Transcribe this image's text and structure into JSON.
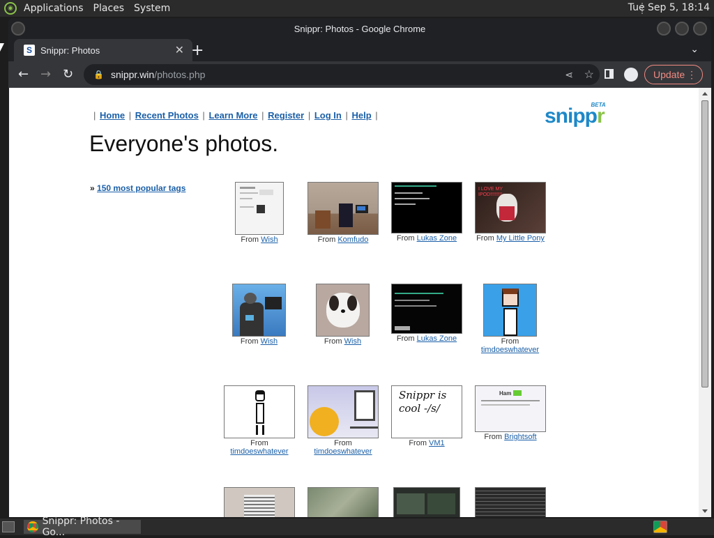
{
  "topbar": {
    "menu": [
      "Applications",
      "Places",
      "System"
    ],
    "clock": "Tue Sep  5, 18:14"
  },
  "window": {
    "title": "Snippr: Photos - Google Chrome",
    "tab_title": "Snippr: Photos",
    "tab_favicon": "S",
    "url_host": "snippr.win",
    "url_path": "/photos.php",
    "update_label": "Update"
  },
  "page": {
    "nav": [
      "Home",
      "Recent Photos",
      "Learn More",
      "Register",
      "Log In",
      "Help"
    ],
    "brand_main": "snipp",
    "brand_accent": "r",
    "brand_beta": "BETA",
    "heading": "Everyone's photos.",
    "tags_prefix": "»",
    "tags_link": "150 most popular tags",
    "from_label": "From",
    "photos": [
      {
        "source": "Wish"
      },
      {
        "source": "Komfudo"
      },
      {
        "source": "Lukas Zone"
      },
      {
        "source": "My Little Pony",
        "overlay": "I LOVE MY IPOD!!!!!!!!!"
      },
      {
        "source": "Wish"
      },
      {
        "source": "Wish"
      },
      {
        "source": "Lukas Zone"
      },
      {
        "source": "timdoeswhatever"
      },
      {
        "source": "timdoeswhatever"
      },
      {
        "source": "timdoeswhatever"
      },
      {
        "source": "VM1",
        "overlay": "Snippr is cool -/s/"
      },
      {
        "source": "Brightsoft",
        "overlay": "Ham"
      }
    ]
  },
  "taskbar": {
    "task_label": "Snippr: Photos - Go..."
  }
}
